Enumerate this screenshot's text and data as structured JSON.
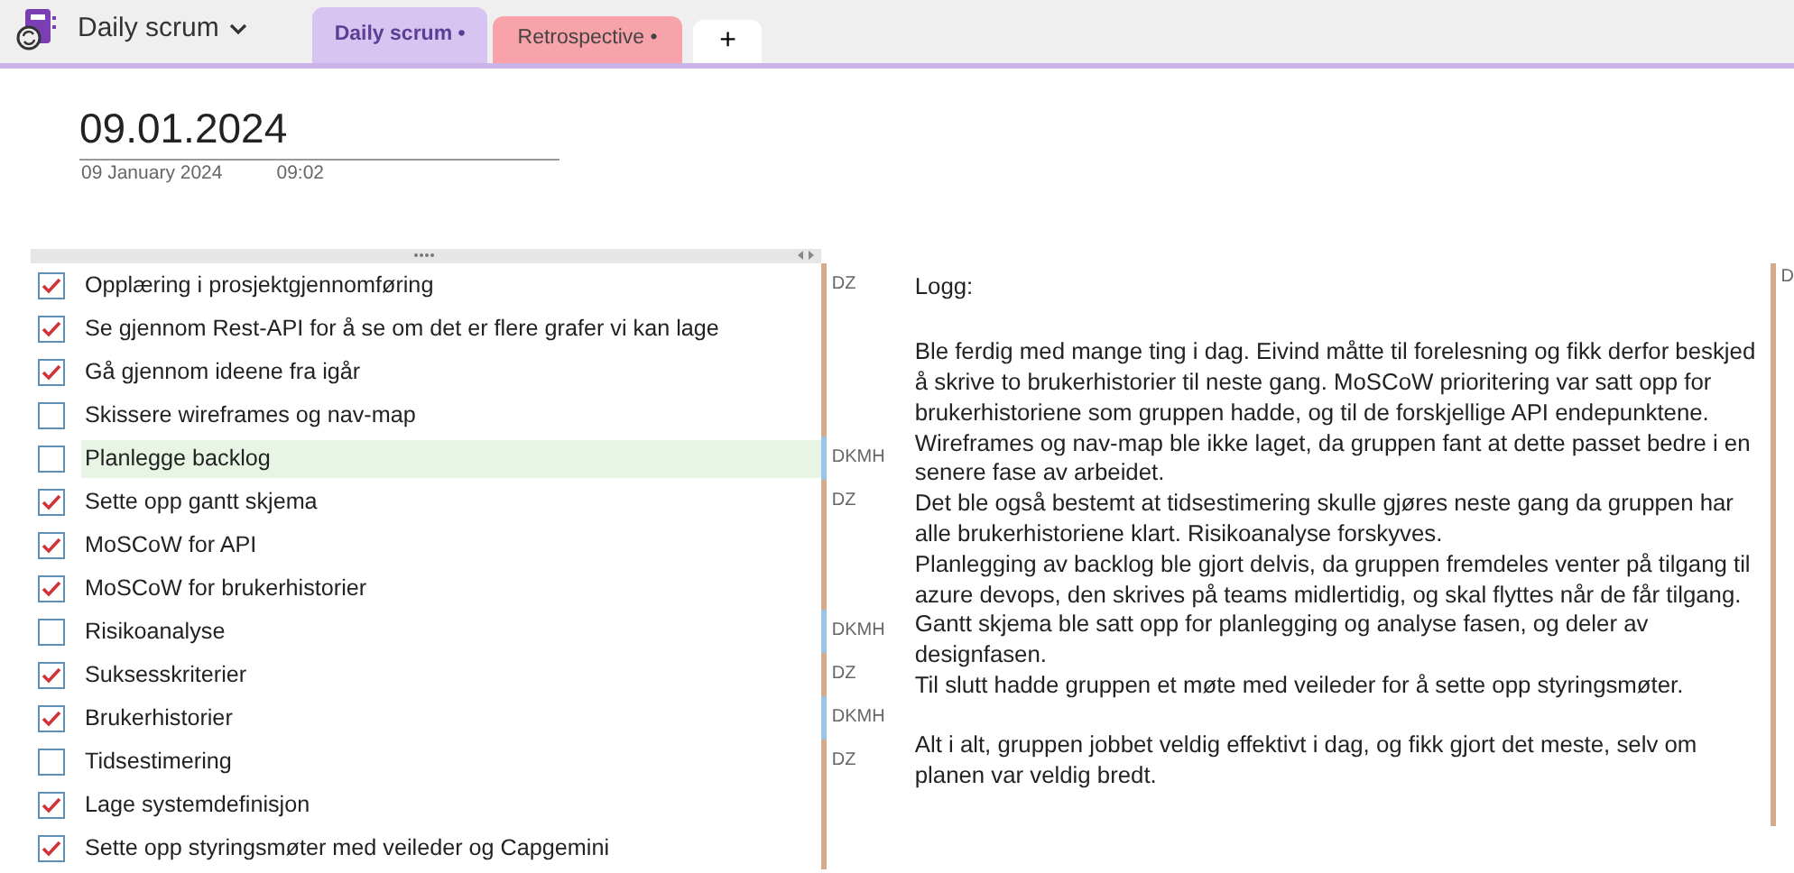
{
  "notebook": {
    "title": "Daily scrum"
  },
  "tabs": [
    {
      "label": "Daily scrum",
      "marker": "•",
      "selected": true,
      "color": "#d7c4f0"
    },
    {
      "label": "Retrospective",
      "marker": "•",
      "selected": false,
      "color": "#f8a3a9"
    }
  ],
  "add_tab": {
    "label": "+"
  },
  "page": {
    "title": "09.01.2024",
    "date": "09 January 2024",
    "time": "09:02"
  },
  "tasks": [
    {
      "label": "Opplæring i prosjektgjennomføring",
      "checked": true,
      "highlighted": false,
      "author": "DZ",
      "color": "#d4ab8c"
    },
    {
      "label": "Se gjennom Rest-API for å se om det er flere grafer vi kan lage",
      "checked": true,
      "highlighted": false
    },
    {
      "label": "Gå gjennom ideene fra igår",
      "checked": true,
      "highlighted": false
    },
    {
      "label": "Skissere wireframes og nav-map",
      "checked": false,
      "highlighted": false
    },
    {
      "label": "Planlegge backlog",
      "checked": false,
      "highlighted": true,
      "author": "DKMH",
      "color": "#9cc3e8"
    },
    {
      "label": "Sette opp gantt skjema",
      "checked": true,
      "highlighted": false,
      "author": "DZ",
      "color": "#d4ab8c"
    },
    {
      "label": "MoSCoW for API",
      "checked": true,
      "highlighted": false
    },
    {
      "label": "MoSCoW for brukerhistorier",
      "checked": true,
      "highlighted": false
    },
    {
      "label": "Risikoanalyse",
      "checked": false,
      "highlighted": false,
      "author": "DKMH",
      "color": "#9cc3e8"
    },
    {
      "label": "Suksesskriterier",
      "checked": true,
      "highlighted": false,
      "author": "DZ",
      "color": "#d4ab8c"
    },
    {
      "label": "Brukerhistorier",
      "checked": true,
      "highlighted": false,
      "author": "DKMH",
      "color": "#9cc3e8"
    },
    {
      "label": "Tidsestimering",
      "checked": false,
      "highlighted": false,
      "author": "DZ",
      "color": "#d4ab8c"
    },
    {
      "label": "Lage systemdefinisjon",
      "checked": true,
      "highlighted": false
    },
    {
      "label": "Sette opp styringsmøter med veileder og Capgemini",
      "checked": true,
      "highlighted": false
    }
  ],
  "log": {
    "title": "Logg:",
    "paragraphs": [
      "Ble ferdig med mange ting i dag. Eivind måtte til forelesning og fikk derfor beskjed å skrive to brukerhistorier til neste gang. MoSCoW prioritering var satt opp for brukerhistoriene som gruppen hadde, og til de forskjellige API endepunktene.",
      "Wireframes og nav-map ble ikke laget, da gruppen fant at dette passet bedre i en senere fase av arbeidet.",
      "Det ble også bestemt at tidsestimering skulle gjøres neste gang da gruppen har alle brukerhistoriene klart. Risikoanalyse forskyves.",
      "Planlegging av backlog ble gjort delvis, da gruppen fremdeles venter på tilgang til azure devops, den skrives på teams midlertidig, og skal flyttes når de får tilgang.",
      "Gantt skjema ble satt opp for planlegging og analyse fasen, og deler av designfasen.",
      "Til slutt hadde gruppen et møte med veileder for å sette opp styringsmøter."
    ],
    "closing": "Alt i alt, gruppen jobbet veldig effektivt i dag, og fikk gjort det meste, selv om planen var veldig bredt.",
    "author": "D",
    "color": "#d4ab8c"
  }
}
